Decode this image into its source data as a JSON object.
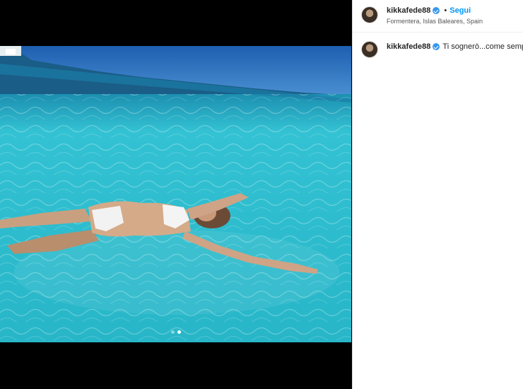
{
  "post": {
    "username": "kikkafede88",
    "verified_icon": "verified-badge-icon",
    "follow_label": "Segui",
    "separator": "•",
    "location": "Formentera, Islas Baleares, Spain",
    "caption": "Ti sognerò...come sempre"
  },
  "media": {
    "description_icon": "photo",
    "carousel": {
      "count": 2,
      "active_index": 2
    }
  },
  "colors": {
    "accent": "#0095f6",
    "verified": "#3897f0",
    "water": "#2ec1cf",
    "sky": "#2a6fb8"
  }
}
